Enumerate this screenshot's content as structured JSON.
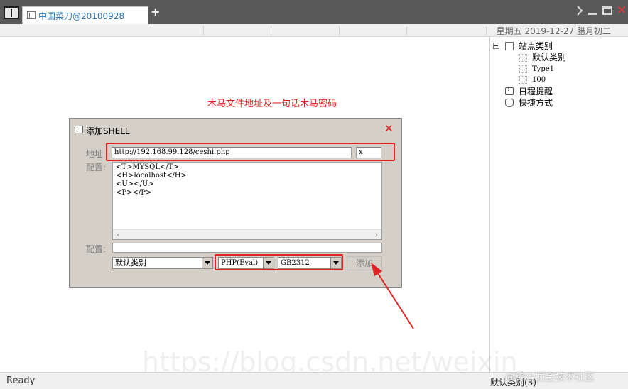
{
  "window": {
    "tab_label": "中国菜刀@20100928",
    "new_tab_symbol": "+",
    "close_symbol": "✕"
  },
  "header": {
    "date": "星期五 2019-12-27 腊月初二"
  },
  "tree": {
    "root": "站点类别",
    "children": [
      "默认类别",
      "Type1",
      "100"
    ],
    "schedule": "日程提醒",
    "shortcuts": "快捷方式"
  },
  "annotation": {
    "text": "木马文件地址及一句话木马密码",
    "color": "#ee1c1c"
  },
  "dialog": {
    "title": "添加SHELL",
    "close_symbol": "✕",
    "address_label": "地址",
    "url": "http://192.168.99.128/ceshi.php",
    "password": "x",
    "config_label": "配置:",
    "config_lines": [
      "<T>MYSQL</T>",
      "<H>localhost</H>",
      "<U></U>",
      "<P></P>"
    ],
    "config2_label": "配置:",
    "config2_value": "",
    "category": "默认类别",
    "script_type": "PHP(Eval)",
    "encoding": "GB2312",
    "add_button": "添加"
  },
  "watermark": "https://blog.csdn.net/weixin_",
  "statusbar": {
    "left": "Ready",
    "right": "默认类别(3)"
  },
  "brand": "@稀土掘金技术社区"
}
